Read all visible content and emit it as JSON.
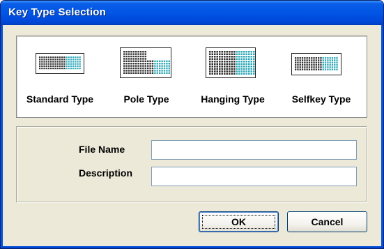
{
  "window": {
    "title": "Key Type Selection"
  },
  "key_types": [
    {
      "label": "Standard Type",
      "icon": "standard-keyboard-icon"
    },
    {
      "label": "Pole Type",
      "icon": "pole-keyboard-icon"
    },
    {
      "label": "Hanging Type",
      "icon": "hanging-keyboard-icon"
    },
    {
      "label": "Selfkey Type",
      "icon": "selfkey-keyboard-icon"
    }
  ],
  "form": {
    "file_name_label": "File Name",
    "file_name_value": "",
    "description_label": "Description",
    "description_value": ""
  },
  "buttons": {
    "ok": "OK",
    "cancel": "Cancel"
  },
  "colors": {
    "title_bar": "#0055e5",
    "dialog_bg": "#ece9d8",
    "key_teal": "#2fa9b8",
    "key_dark": "#333333"
  }
}
